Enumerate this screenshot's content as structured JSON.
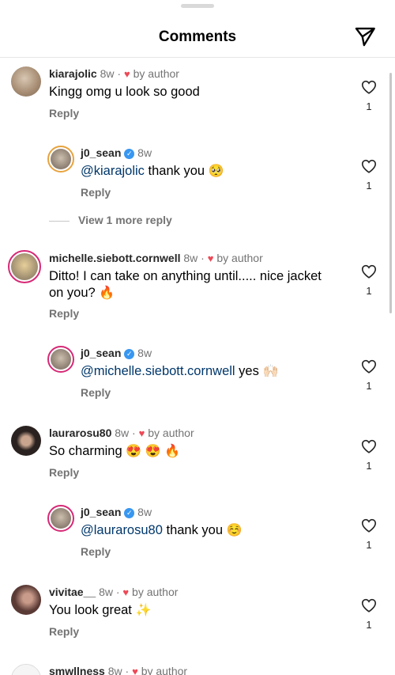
{
  "header": {
    "title": "Comments"
  },
  "comments": [
    {
      "user": "kiarajolic",
      "time": "8w",
      "by": "by author",
      "text": "Kingg omg u look so good",
      "reply": "Reply",
      "likes": "1"
    },
    {
      "user": "j0_sean",
      "time": "8w",
      "mention": "@kiarajolic",
      "text": "thank you",
      "emoji": "🥺",
      "reply": "Reply",
      "likes": "1"
    },
    {
      "user": "michelle.siebott.cornwell",
      "time": "8w",
      "by": "by author",
      "text": "Ditto! I can take on anything until..... nice jacket on you?",
      "emoji": "🔥",
      "reply": "Reply",
      "likes": "1"
    },
    {
      "user": "j0_sean",
      "time": "8w",
      "mention": "@michelle.siebott.cornwell",
      "text": "yes",
      "emoji": "🙌🏻",
      "reply": "Reply",
      "likes": "1"
    },
    {
      "user": "laurarosu80",
      "time": "8w",
      "by": "by author",
      "text": "So charming",
      "emoji": "😍 😍 🔥",
      "reply": "Reply",
      "likes": "1"
    },
    {
      "user": "j0_sean",
      "time": "8w",
      "mention": "@laurarosu80",
      "text": "thank you",
      "emoji": "☺️",
      "reply": "Reply",
      "likes": "1"
    },
    {
      "user": "vivitae__",
      "time": "8w",
      "by": "by author",
      "text": "You look great",
      "emoji": "✨",
      "reply": "Reply",
      "likes": "1"
    },
    {
      "user": "smwllness",
      "time": "8w",
      "by": "by author"
    }
  ],
  "view_more": "View 1 more reply",
  "colors": {
    "accent_link": "#00376b",
    "heart": "#ed4956",
    "verified": "#3897f0",
    "muted": "#737373"
  },
  "icons": [
    "send-icon",
    "heart-outline-icon",
    "heart-filled-icon",
    "verified-badge-icon"
  ]
}
